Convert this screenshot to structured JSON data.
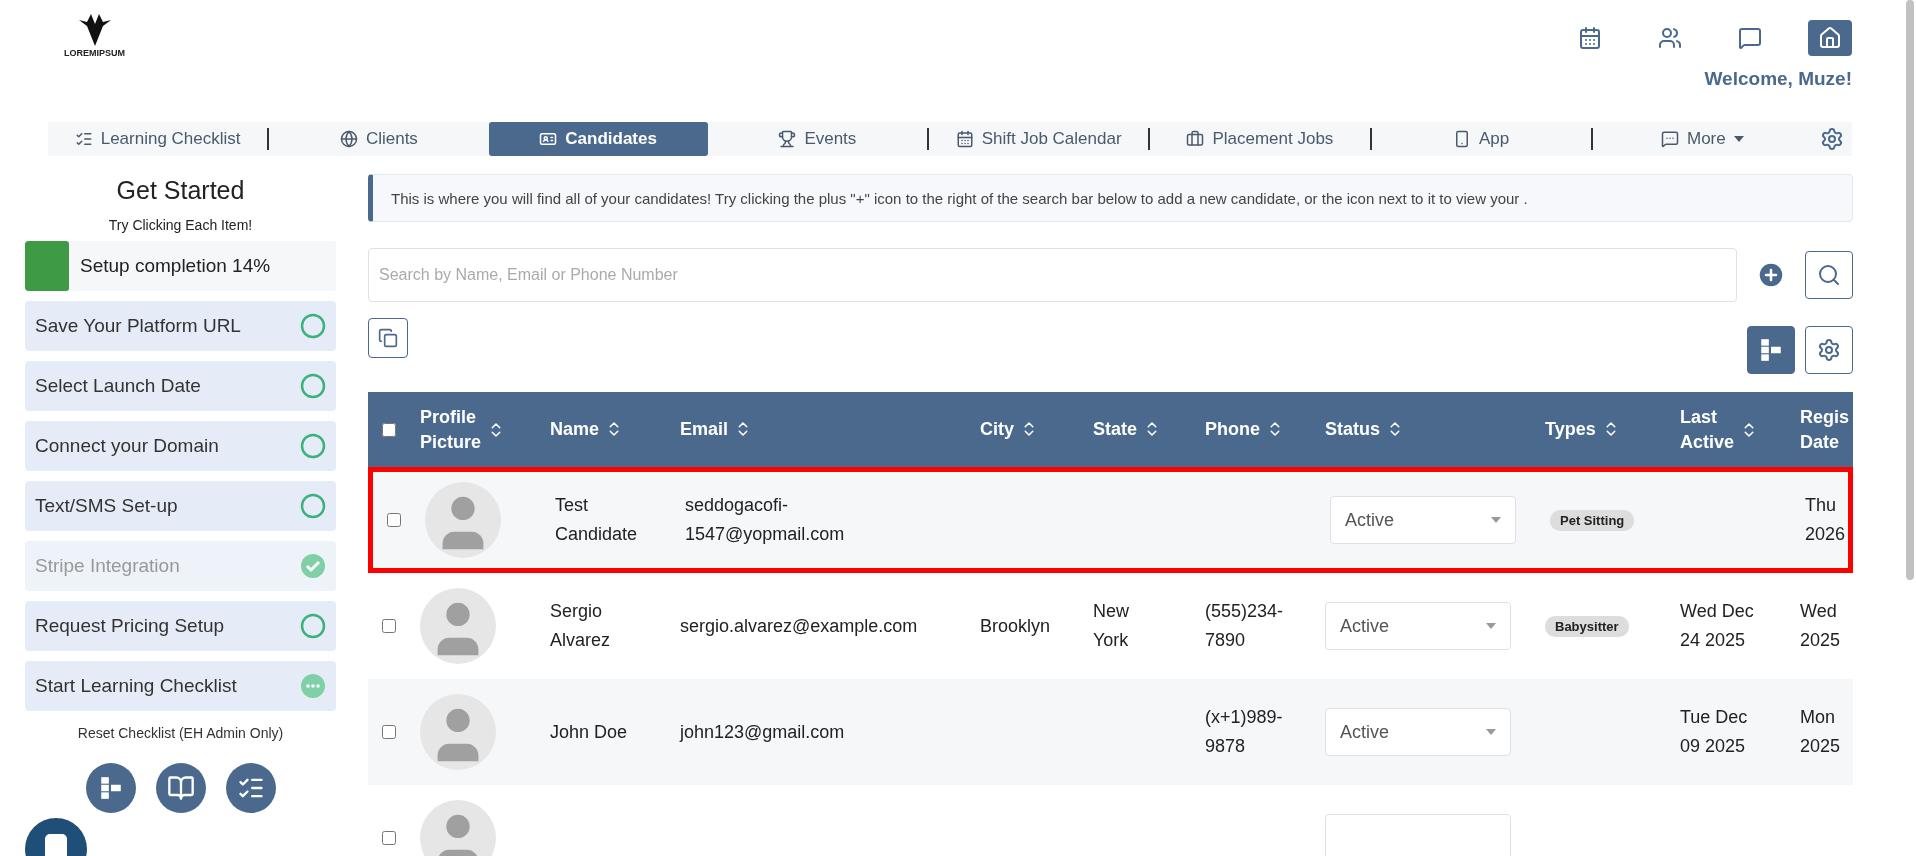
{
  "header": {
    "logo_text": "LOREMIPSUM",
    "welcome": "Welcome, Muze!",
    "icons": [
      {
        "kind": "calendar",
        "selected": false
      },
      {
        "kind": "users",
        "selected": false
      },
      {
        "kind": "chat",
        "selected": false
      },
      {
        "kind": "home",
        "selected": true
      }
    ]
  },
  "nav": {
    "tabs": [
      {
        "label": "Learning Checklist",
        "selected": false,
        "caret": false
      },
      {
        "label": "Clients",
        "selected": false,
        "caret": false
      },
      {
        "label": "Candidates",
        "selected": true,
        "caret": false
      },
      {
        "label": "Events",
        "selected": false,
        "caret": false
      },
      {
        "label": "Shift Job Calendar",
        "selected": false,
        "caret": false
      },
      {
        "label": "Placement Jobs",
        "selected": false,
        "caret": false
      },
      {
        "label": "App",
        "selected": false,
        "caret": false
      },
      {
        "label": "More",
        "selected": false,
        "caret": true
      }
    ]
  },
  "sidebar": {
    "title": "Get Started",
    "subtitle": "Try Clicking Each Item!",
    "progress": {
      "label": "Setup completion 14%",
      "level": 0.14
    },
    "items": [
      {
        "label": "Save Your Platform URL",
        "kind": "todo"
      },
      {
        "label": "Select Launch Date",
        "kind": "todo"
      },
      {
        "label": "Connect your Domain",
        "kind": "todo"
      },
      {
        "label": "Text/SMS Set-up",
        "kind": "todo"
      },
      {
        "label": "Stripe Integration",
        "kind": "done"
      },
      {
        "label": "Request Pricing Setup",
        "kind": "todo"
      },
      {
        "label": "Start Learning Checklist",
        "kind": "pending"
      }
    ],
    "reset": "Reset Checklist (EH Admin Only)"
  },
  "banner": "This is where you will find all of your candidates! Try clicking the plus \"+\" icon to the right of the search bar below to add a new candidate, or the icon next to it to view your .",
  "search": {
    "placeholder": "Search by Name, Email or Phone Number"
  },
  "table": {
    "all_checked": false,
    "columns": [
      "Profile Picture",
      "Name",
      "Email",
      "City",
      "State",
      "Phone",
      "Status",
      "Types",
      "Last Active",
      "Regis Date"
    ],
    "rows": [
      {
        "checked": false,
        "highlighted": true,
        "name": "Test Candidate",
        "email": "seddogacofi-1547@yopmail.com",
        "city": "",
        "state": "",
        "phone": "",
        "status": "Active",
        "type": "Pet Sitting",
        "last_active": "",
        "registered": "Thu 2026"
      },
      {
        "checked": false,
        "highlighted": false,
        "name": "Sergio Alvarez",
        "email": "sergio.alvarez@example.com",
        "city": "Brooklyn",
        "state": "New York",
        "phone": "(555)234-7890",
        "status": "Active",
        "type": "Babysitter",
        "last_active": "Wed Dec 24 2025",
        "registered": "Wed 2025"
      },
      {
        "checked": false,
        "highlighted": false,
        "name": "John Doe",
        "email": "john123@gmail.com",
        "city": "",
        "state": "",
        "phone": "(x+1)989-9878",
        "status": "Active",
        "type": "",
        "last_active": "Tue Dec 09 2025",
        "registered": "Mon 2025"
      },
      {
        "checked": false,
        "highlighted": false,
        "name": "",
        "email": "",
        "city": "",
        "state": "",
        "phone": "",
        "status": "",
        "type": "",
        "last_active": "",
        "registered": ""
      }
    ]
  }
}
